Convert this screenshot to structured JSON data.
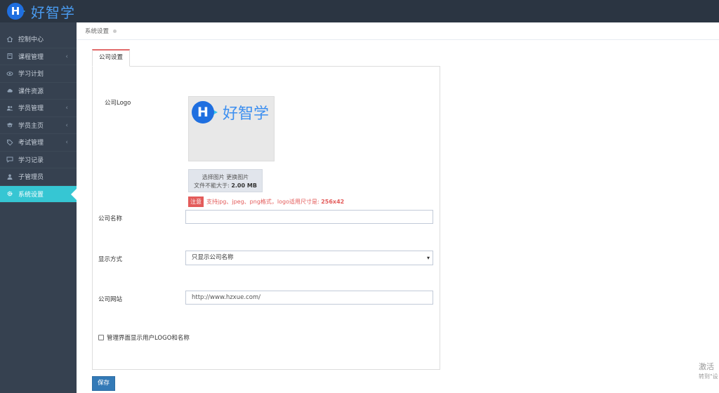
{
  "brand": {
    "logo_letter": "H",
    "name": "好智学"
  },
  "sidebar": {
    "items": [
      {
        "label": "控制中心",
        "icon": "home-icon",
        "has_arrow": false
      },
      {
        "label": "课程管理",
        "icon": "book-icon",
        "has_arrow": true
      },
      {
        "label": "学习计划",
        "icon": "eye-icon",
        "has_arrow": false
      },
      {
        "label": "课件资源",
        "icon": "cloud-icon",
        "has_arrow": false
      },
      {
        "label": "学员管理",
        "icon": "users-icon",
        "has_arrow": true
      },
      {
        "label": "学员主页",
        "icon": "graduation-cap-icon",
        "has_arrow": true
      },
      {
        "label": "考试管理",
        "icon": "tag-icon",
        "has_arrow": true
      },
      {
        "label": "学习记录",
        "icon": "bubble-icon",
        "has_arrow": false
      },
      {
        "label": "子管理员",
        "icon": "user-icon",
        "has_arrow": false
      },
      {
        "label": "系统设置",
        "icon": "gear-icon",
        "has_arrow": false,
        "active": true
      }
    ],
    "arrow": "‹"
  },
  "breadcrumb": {
    "text": "系统设置"
  },
  "tab": {
    "label": "公司设置"
  },
  "form": {
    "logo_label": "公司Logo",
    "logo_preview": {
      "letter": "H",
      "text": "好智学"
    },
    "upload": {
      "line1": "选择图片 更换图片",
      "line2_prefix": "文件不能大于: ",
      "line2_value": "2.00 MB"
    },
    "note": {
      "badge": "注意",
      "text": "支持jpg、jpeg、png格式，logo适用尺寸是: ",
      "size": "256x42"
    },
    "company_name": {
      "label": "公司名称",
      "value": ""
    },
    "display_mode": {
      "label": "显示方式",
      "selected": "只显示公司名称"
    },
    "website": {
      "label": "公司网站",
      "value": "http://www.hzxue.com/"
    },
    "checkbox": {
      "label": "管理界面显示用户LOGO和名称",
      "checked": false
    },
    "save_label": "保存"
  },
  "watermark": {
    "line1": "激活",
    "line2": "转到\"设"
  },
  "colors": {
    "topbar": "#2b3542",
    "sidebar": "#364150",
    "active": "#36c6d3",
    "tab_accent": "#e26a6a",
    "note": "#e35b5a",
    "save": "#337ab7"
  }
}
